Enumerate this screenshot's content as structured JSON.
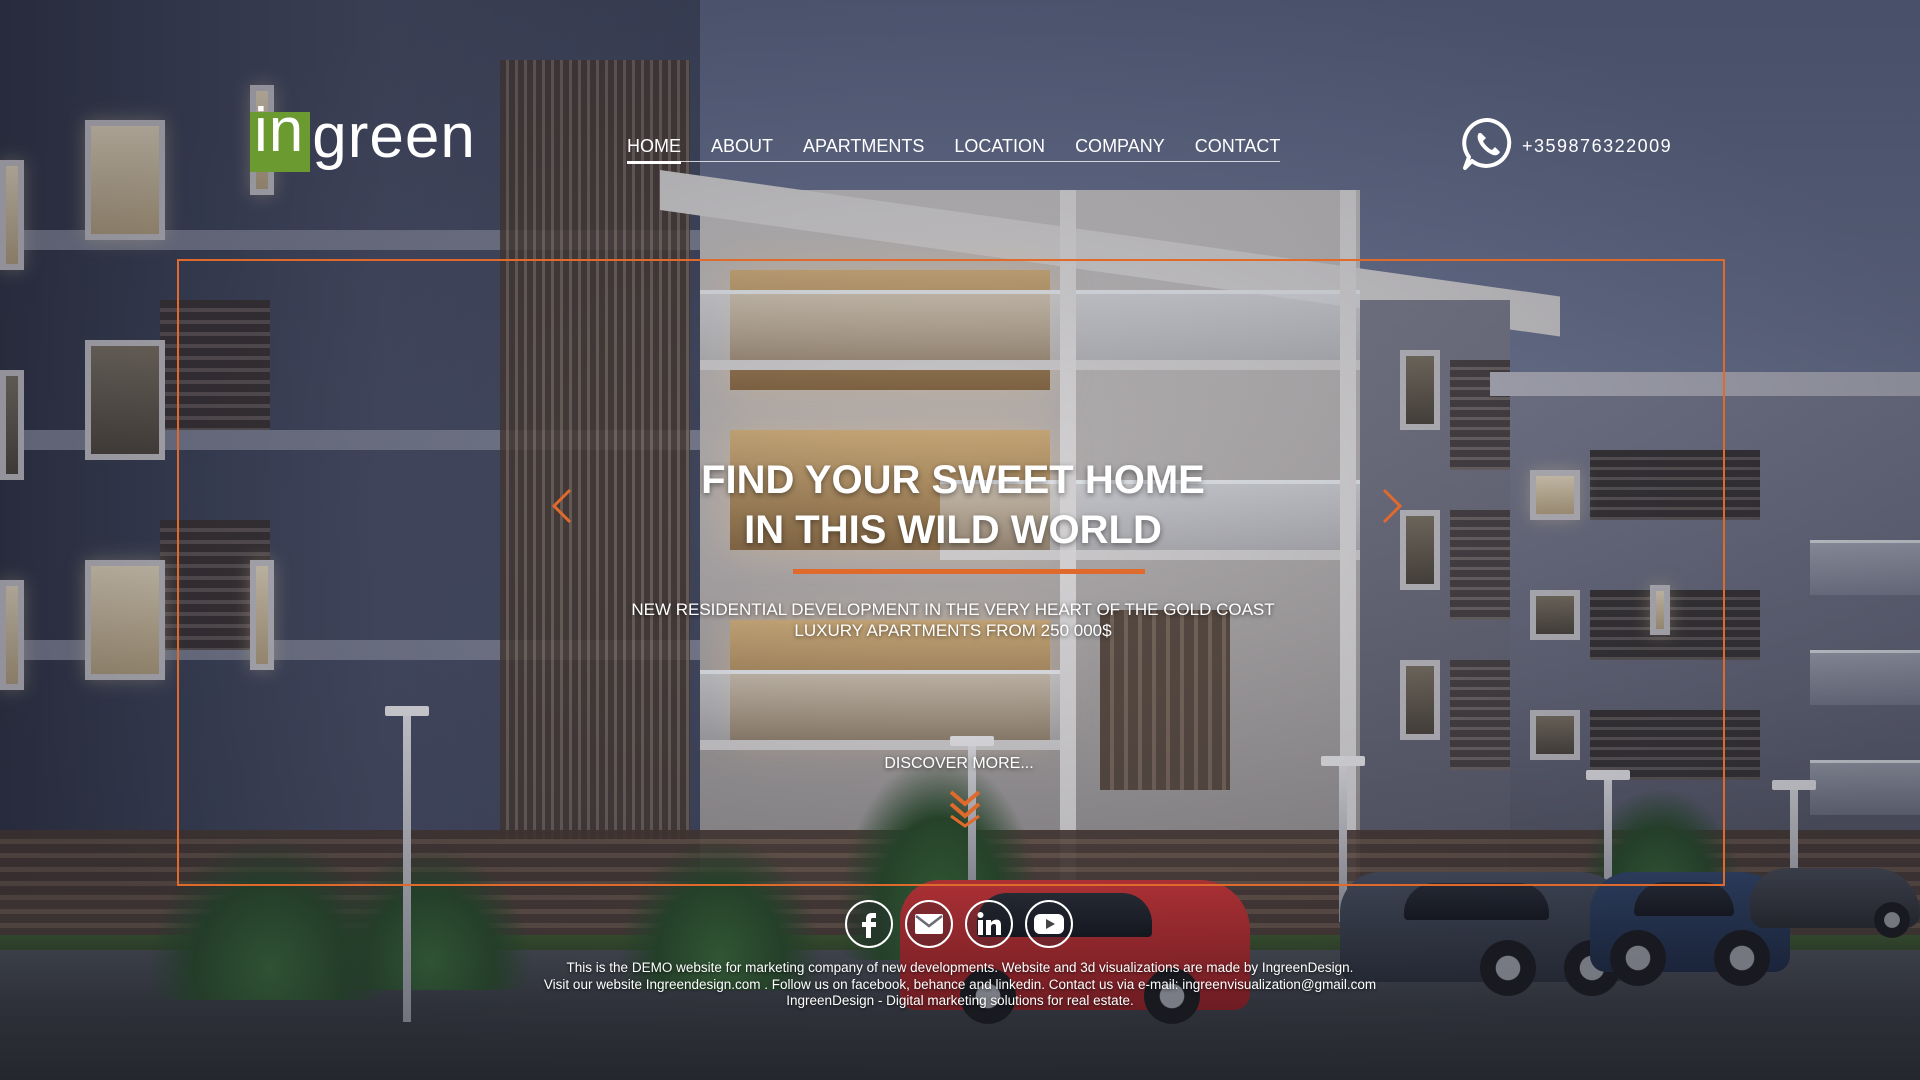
{
  "logo": {
    "part1": "in",
    "part2": "green"
  },
  "nav": {
    "items": [
      {
        "label": "HOME",
        "active": true
      },
      {
        "label": "ABOUT"
      },
      {
        "label": "APARTMENTS"
      },
      {
        "label": "LOCATION"
      },
      {
        "label": "COMPANY"
      },
      {
        "label": "CONTACT"
      }
    ]
  },
  "phone": {
    "icon": "whatsapp-icon",
    "number": "+359876322009"
  },
  "hero": {
    "headline_line1": "FIND YOUR SWEET HOME",
    "headline_line2": "IN THIS WILD WORLD",
    "sub_line1": "NEW RESIDENTIAL DEVELOPMENT IN THE VERY HEART OF THE GOLD COAST",
    "sub_line2": "LUXURY APARTMENTS FROM 250 000$",
    "discover": "DISCOVER MORE...",
    "prev_icon": "chevron-left-icon",
    "next_icon": "chevron-right-icon",
    "scroll_icon": "double-chevron-down-icon"
  },
  "social": {
    "items": [
      {
        "icon": "facebook-icon"
      },
      {
        "icon": "email-icon"
      },
      {
        "icon": "linkedin-icon"
      },
      {
        "icon": "youtube-icon"
      }
    ]
  },
  "footer": {
    "line1": "This is the DEMO website for marketing company of new developments. Website and 3d visualizations are made by IngreenDesign.",
    "line2": "Visit our website Ingreendesign.com . Follow us on facebook, behance and linkedin. Contact us via e-mail: ingreenvisualization@gmail.com",
    "line3": "IngreenDesign - Digital marketing solutions for real estate."
  },
  "colors": {
    "accent": "#e06a2c",
    "logo_green": "#6a9a30",
    "text": "#ffffff"
  }
}
